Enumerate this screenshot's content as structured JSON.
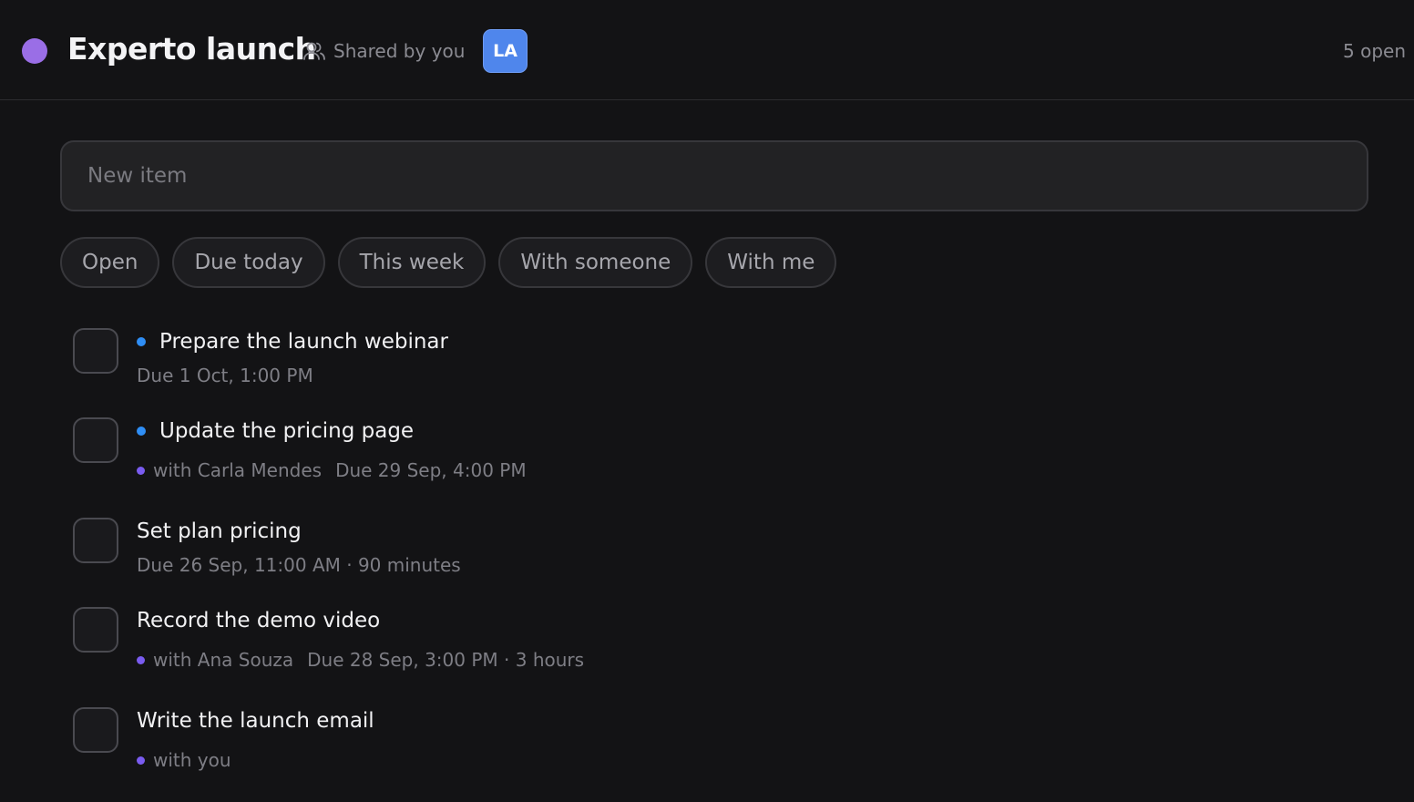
{
  "colors": {
    "list_dot": "#9a6ee6",
    "avatar_bg": "#4f86ec",
    "unread_dot": "#2f8ef5",
    "person_dot": "#7a5cf0"
  },
  "header": {
    "title": "Experto launch",
    "share_icon": "people-icon",
    "share_text": "Shared by you",
    "avatar_initials": "LA",
    "open_count": "5 open"
  },
  "new_item": {
    "placeholder": "New item",
    "value": ""
  },
  "filters": [
    {
      "label": "Open"
    },
    {
      "label": "Due today"
    },
    {
      "label": "This week"
    },
    {
      "label": "With someone"
    },
    {
      "label": "With me"
    }
  ],
  "tasks": [
    {
      "title": "Prepare the launch webinar",
      "unread": true,
      "with": "",
      "due": "Due 1 Oct, 1:00 PM"
    },
    {
      "title": "Update the pricing page",
      "unread": true,
      "with": "with Carla Mendes",
      "due": "Due 29 Sep, 4:00 PM"
    },
    {
      "title": "Set plan pricing",
      "unread": false,
      "with": "",
      "due": "Due 26 Sep, 11:00 AM · 90 minutes"
    },
    {
      "title": "Record the demo video",
      "unread": false,
      "with": "with Ana Souza",
      "due": "Due 28 Sep, 3:00 PM · 3 hours"
    },
    {
      "title": "Write the launch email",
      "unread": false,
      "with": "with you",
      "due": ""
    }
  ]
}
